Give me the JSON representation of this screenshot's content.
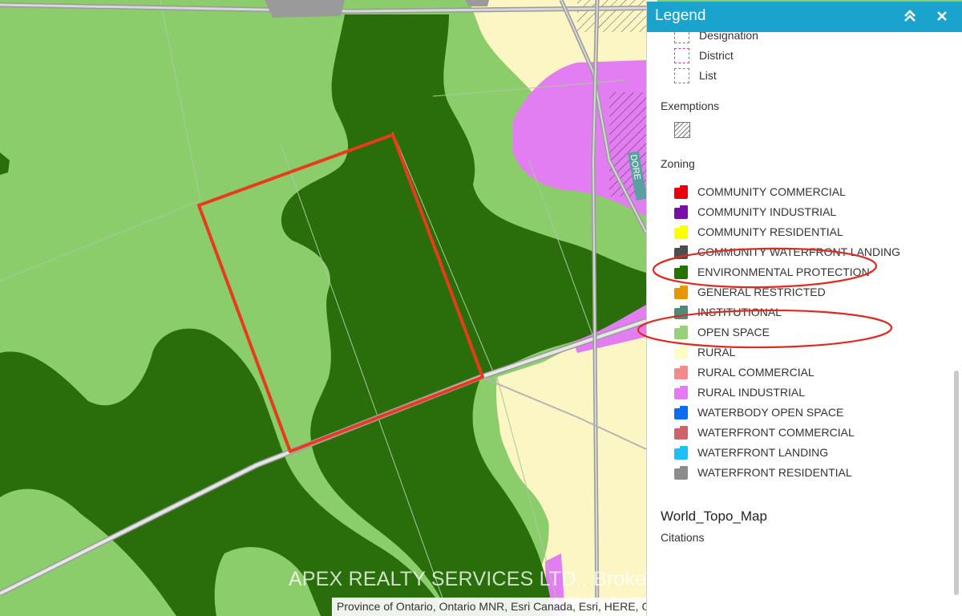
{
  "legend": {
    "title": "Legend",
    "overlay_section": {
      "items": [
        {
          "label": "Designation",
          "color": "#c43fc4"
        },
        {
          "label": "District",
          "color": "#c43fc4"
        },
        {
          "label": "List",
          "color": "#3b8ede"
        }
      ]
    },
    "exemptions": {
      "title": "Exemptions",
      "symbol": "hatch-pattern-icon"
    },
    "zoning": {
      "title": "Zoning",
      "items": [
        {
          "label": "COMMUNITY COMMERCIAL",
          "color": "#e8000b"
        },
        {
          "label": "COMMUNITY INDUSTRIAL",
          "color": "#7a0fa8"
        },
        {
          "label": "COMMUNITY RESIDENTIAL",
          "color": "#ffff00"
        },
        {
          "label": "COMMUNITY WATERFRONT LANDING",
          "color": "#4d4d4d"
        },
        {
          "label": "ENVIRONMENTAL PROTECTION",
          "color": "#267300"
        },
        {
          "label": "GENERAL RESTRICTED",
          "color": "#e69800"
        },
        {
          "label": "INSTITUTIONAL",
          "color": "#4e8a79"
        },
        {
          "label": "OPEN SPACE",
          "color": "#98d17a"
        },
        {
          "label": "RURAL",
          "color": "#fcfcc4"
        },
        {
          "label": "RURAL COMMERCIAL",
          "color": "#f48a8a"
        },
        {
          "label": "RURAL INDUSTRIAL",
          "color": "#e67af5"
        },
        {
          "label": "WATERBODY OPEN SPACE",
          "color": "#0a6cf0"
        },
        {
          "label": "WATERFRONT COMMERCIAL",
          "color": "#cf6468"
        },
        {
          "label": "WATERFRONT LANDING",
          "color": "#1ec0f5"
        },
        {
          "label": "WATERFRONT RESIDENTIAL",
          "color": "#8c8c8c"
        }
      ]
    },
    "basemap": {
      "title": "World_Topo_Map",
      "subtitle": "Citations"
    }
  },
  "map": {
    "watermark": "APEX REALTY SERVICES LTD., Brokerage",
    "attribution": "Province of Ontario, Ontario MNR, Esri Canada, Esri, HERE, G",
    "road_label": "DORE",
    "colors": {
      "open_space": "#8ccd6b",
      "environmental_protection": "#2a6e0c",
      "rural": "#fbf6c3",
      "rural_industrial": "#e27ef2",
      "highlight": "#ea3a1c",
      "header": "#1aa3cc"
    }
  }
}
